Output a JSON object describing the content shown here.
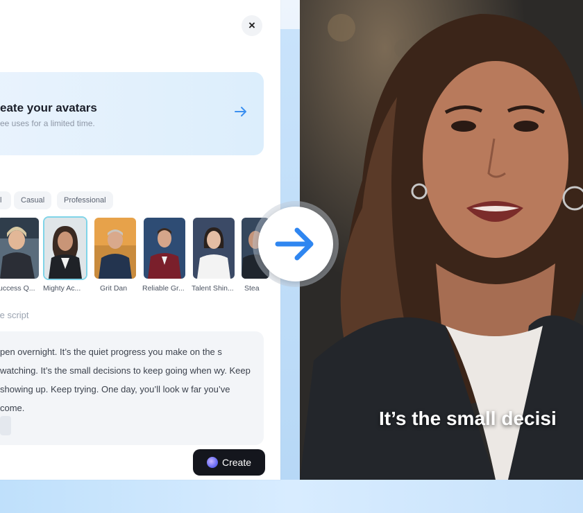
{
  "close": {
    "label": "×"
  },
  "banner": {
    "title": "eate your avatars",
    "subtitle": "ee uses for a limited time."
  },
  "filters": [
    "l",
    "Casual",
    "Professional"
  ],
  "avatars": [
    {
      "name": "uccess Q..."
    },
    {
      "name": "Mighty Ac..."
    },
    {
      "name": "Grit Dan"
    },
    {
      "name": "Reliable Gr..."
    },
    {
      "name": "Talent Shin..."
    },
    {
      "name": "Stea"
    }
  ],
  "script": {
    "label": "te script",
    "text": "pen overnight. It’s the quiet progress you make on the s watching. It’s the small decisions to keep going when wy. Keep showing up. Keep trying. One day, you’ll look w far you’ve come."
  },
  "create": {
    "label": "Create"
  },
  "video": {
    "subtitle": "It’s the small decisi"
  },
  "colors": {
    "accent": "#3b8ff0",
    "create_bg": "#14161d",
    "selected_border": "#7fd4e8"
  }
}
